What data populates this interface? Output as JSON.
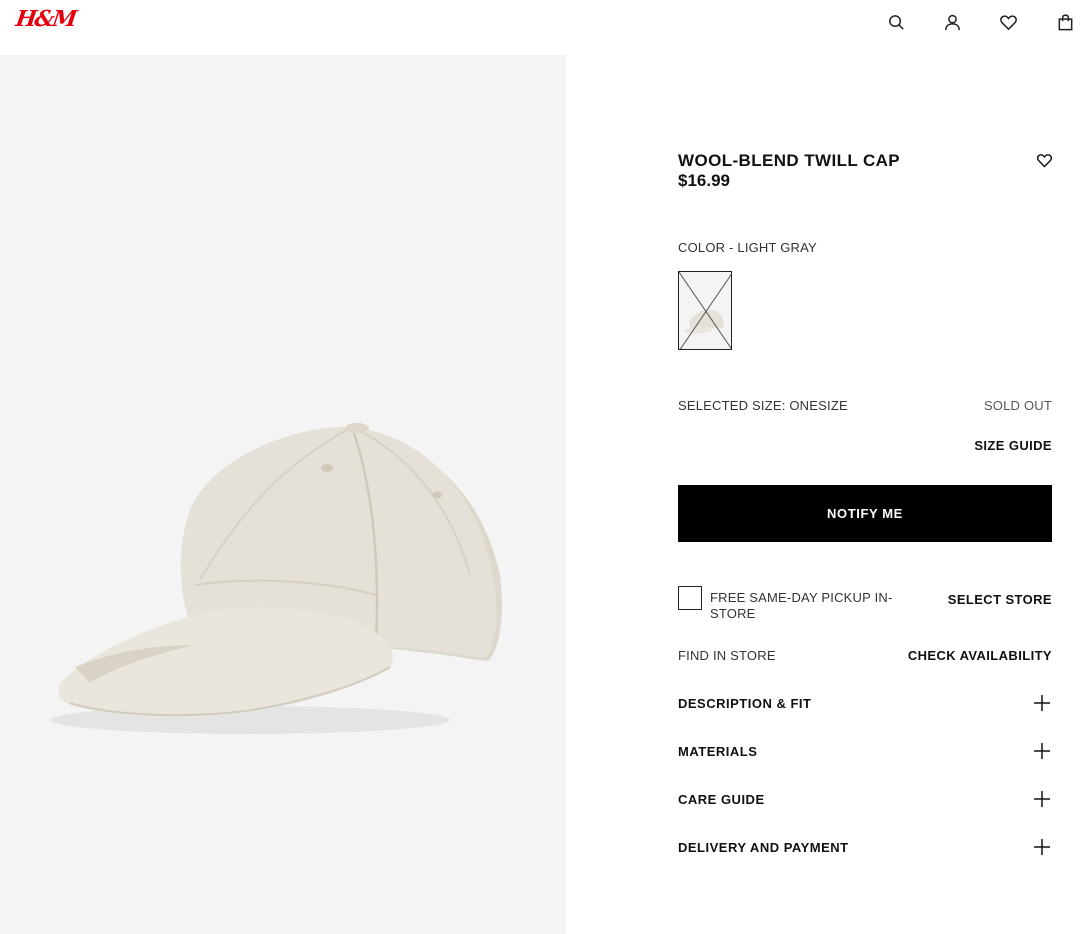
{
  "header": {
    "logo": "H&M",
    "icons": [
      "search-icon",
      "account-icon",
      "favorites-icon",
      "bag-icon"
    ]
  },
  "product": {
    "title": "WOOL-BLEND TWILL CAP",
    "price": "$16.99",
    "color_label": "COLOR - LIGHT GRAY",
    "selected_size_label": "SELECTED SIZE: ONESIZE",
    "size_status": "SOLD OUT",
    "size_guide": "SIZE GUIDE",
    "notify_button": "NOTIFY ME",
    "pickup_label": "FREE SAME-DAY PICKUP IN-STORE",
    "pickup_checked": false,
    "select_store": "SELECT STORE",
    "find_in_store": "FIND IN STORE",
    "check_availability": "CHECK AVAILABILITY"
  },
  "accordion": [
    {
      "label": "DESCRIPTION & FIT"
    },
    {
      "label": "MATERIALS"
    },
    {
      "label": "CARE GUIDE"
    },
    {
      "label": "DELIVERY AND PAYMENT"
    }
  ],
  "colors": {
    "brand": "#e50010",
    "button_bg": "#000000",
    "image_bg": "#f4f4f4",
    "cap": "#e6e1d8"
  }
}
